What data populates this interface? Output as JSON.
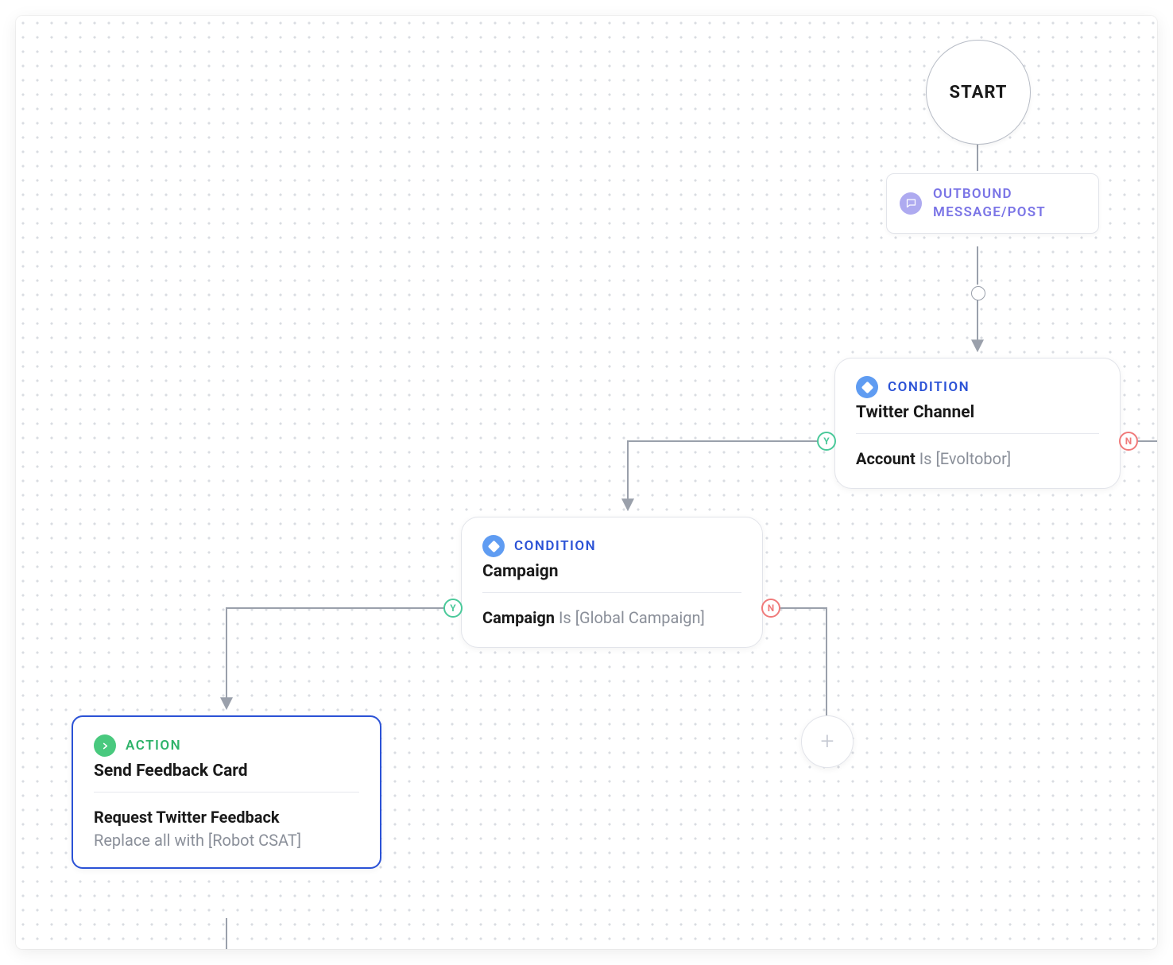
{
  "start": {
    "label": "START"
  },
  "trigger": {
    "label": "OUTBOUND MESSAGE/POST"
  },
  "condition1": {
    "type_label": "CONDITION",
    "title": "Twitter Channel",
    "rule_field": "Account",
    "rule_op": "Is",
    "rule_value": "[Evoltobor]"
  },
  "condition2": {
    "type_label": "CONDITION",
    "title": "Campaign",
    "rule_field": "Campaign",
    "rule_op": "Is",
    "rule_value": "[Global Campaign]"
  },
  "action1": {
    "type_label": "ACTION",
    "title": "Send Feedback Card",
    "rule_field": "Request Twitter Feedback",
    "rule_sub": "Replace all with [Robot CSAT]"
  },
  "badges": {
    "yes": "Y",
    "no": "N"
  },
  "add_label": "+"
}
